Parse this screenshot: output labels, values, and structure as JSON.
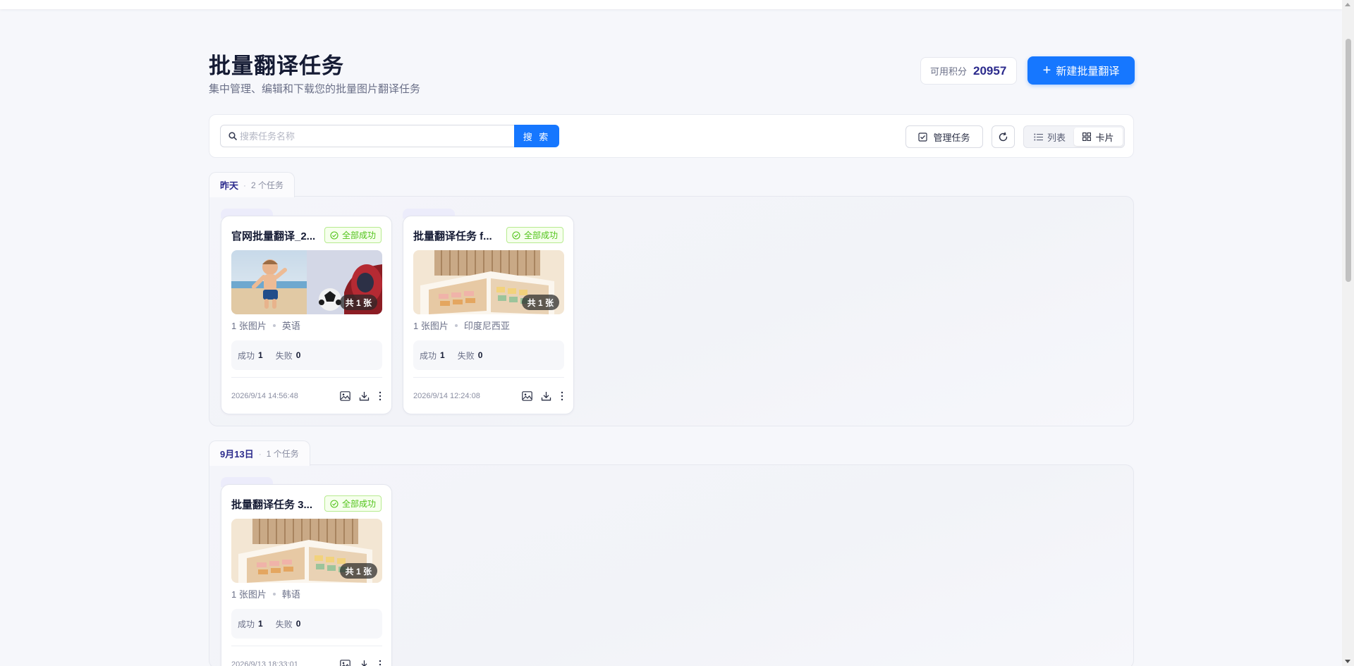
{
  "header": {
    "title": "批量翻译任务",
    "subtitle": "集中管理、编辑和下载您的批量图片翻译任务",
    "credits_label": "可用积分",
    "credits_value": "20957",
    "new_button_label": "新建批量翻译"
  },
  "toolbar": {
    "search_placeholder": "搜索任务名称",
    "search_button_label": "搜 索",
    "manage_button_label": "管理任务",
    "view_list_label": "列表",
    "view_card_label": "卡片"
  },
  "groups": [
    {
      "title": "昨天",
      "count_label": "2 个任务",
      "cards": [
        {
          "title": "官网批量翻译_2...",
          "status": "全部成功",
          "image_count": "共 1 张",
          "images_label": "1 张图片",
          "language": "英语",
          "success_label": "成功",
          "success_count": "1",
          "fail_label": "失败",
          "fail_count": "0",
          "time": "2026/9/14 14:56:48"
        },
        {
          "title": "批量翻译任务 f...",
          "status": "全部成功",
          "image_count": "共 1 张",
          "images_label": "1 张图片",
          "language": "印度尼西亚",
          "success_label": "成功",
          "success_count": "1",
          "fail_label": "失败",
          "fail_count": "0",
          "time": "2026/9/14 12:24:08"
        }
      ]
    },
    {
      "title": "9月13日",
      "count_label": "1 个任务",
      "cards": [
        {
          "title": "批量翻译任务 3...",
          "status": "全部成功",
          "image_count": "共 1 张",
          "images_label": "1 张图片",
          "language": "韩语",
          "success_label": "成功",
          "success_count": "1",
          "fail_label": "失败",
          "fail_count": "0",
          "time": "2026/9/13 18:33:01"
        }
      ]
    }
  ],
  "colors": {
    "primary": "#1677ff",
    "credits_value": "#2b2a8c",
    "success_text": "#52c41a",
    "success_border": "#b7eb8f",
    "success_bg": "#f6ffed"
  }
}
